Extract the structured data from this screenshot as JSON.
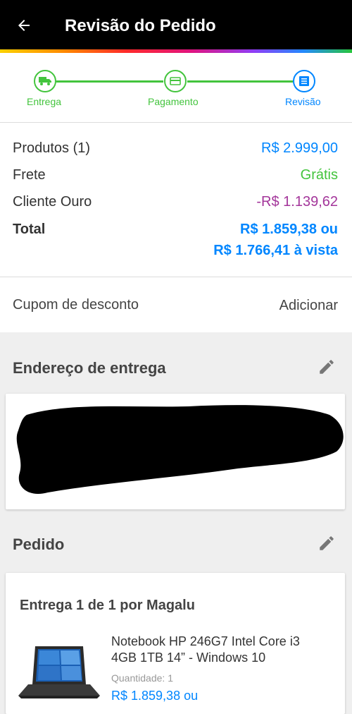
{
  "header": {
    "title": "Revisão do Pedido"
  },
  "steps": [
    {
      "label": "Entrega",
      "icon": "truck-icon"
    },
    {
      "label": "Pagamento",
      "icon": "card-icon"
    },
    {
      "label": "Revisão",
      "icon": "list-icon"
    }
  ],
  "summary": {
    "products_label": "Produtos (1)",
    "products_value": "R$ 2.999,00",
    "shipping_label": "Frete",
    "shipping_value": "Grátis",
    "gold_label": "Cliente Ouro",
    "gold_value": "-R$ 1.139,62",
    "total_label": "Total",
    "total_value_line1": "R$ 1.859,38 ou",
    "total_value_line2": "R$ 1.766,41 à vista"
  },
  "coupon": {
    "label": "Cupom de desconto",
    "action": "Adicionar"
  },
  "address": {
    "title": "Endereço de entrega"
  },
  "order": {
    "title": "Pedido",
    "delivery": "Entrega 1 de 1 por Magalu",
    "product_name_line1": "Notebook HP 246G7 Intel Core i3",
    "product_name_line2": "4GB 1TB 14” - Windows 10",
    "quantity_label": "Quantidade:",
    "quantity_value": "1",
    "price": "R$ 1.859,38 ou"
  },
  "colors": {
    "green": "#43c43d",
    "blue": "#0086ff",
    "purple": "#a3359a"
  }
}
